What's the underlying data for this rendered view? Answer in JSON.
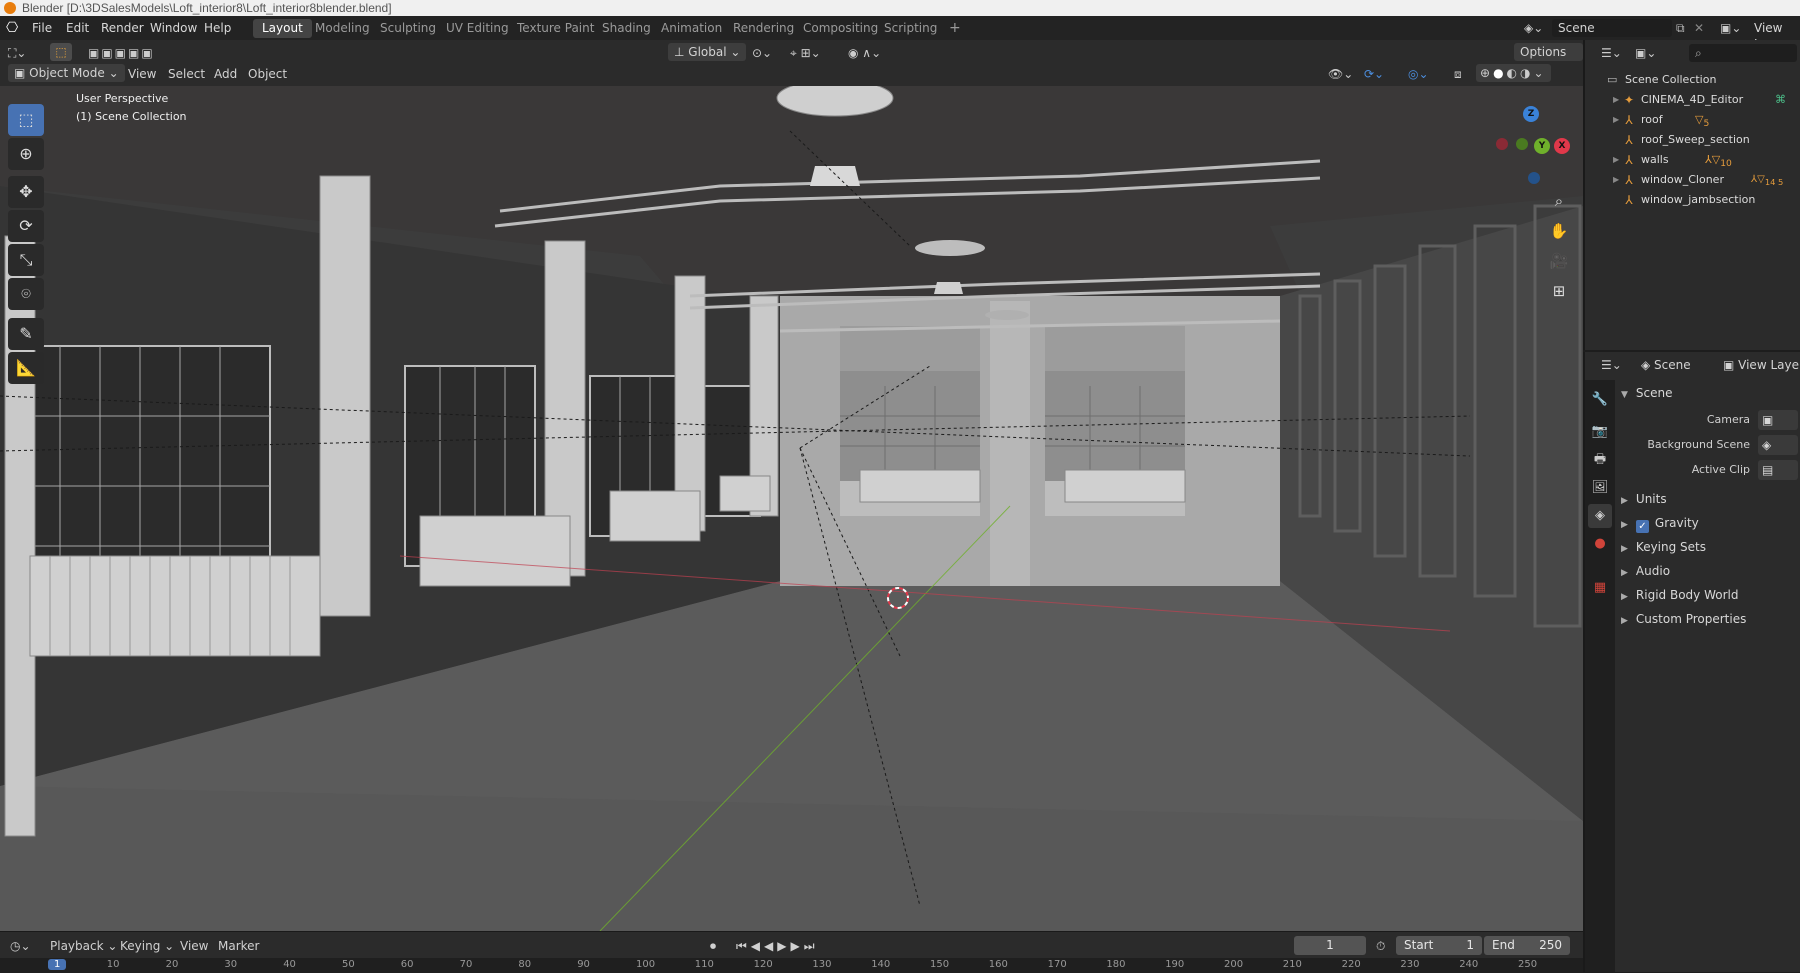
{
  "window": {
    "title": "Blender [D:\\3DSalesModels\\Loft_interior8\\Loft_interior8blender.blend]"
  },
  "menu": [
    "File",
    "Edit",
    "Render",
    "Window",
    "Help"
  ],
  "workspaces": [
    "Layout",
    "Modeling",
    "Sculpting",
    "UV Editing",
    "Texture Paint",
    "Shading",
    "Animation",
    "Rendering",
    "Compositing",
    "Scripting"
  ],
  "active_workspace": "Layout",
  "add_workspace": "+",
  "scene_selector": {
    "label": "Scene",
    "view_layer": "View Lay"
  },
  "viewport_header": {
    "mode": "Object Mode",
    "menus": [
      "View",
      "Select",
      "Add",
      "Object"
    ],
    "orientation": "Global",
    "options": "Options"
  },
  "viewport_overlay": {
    "perspective": "User Perspective",
    "collection": "(1) Scene Collection"
  },
  "gizmo": {
    "x": "X",
    "y": "Y",
    "z": "Z"
  },
  "outliner": {
    "root": "Scene Collection",
    "items": [
      {
        "name": "CINEMA_4D_Editor",
        "badge": ""
      },
      {
        "name": "roof",
        "badge": "5"
      },
      {
        "name": "roof_Sweep_section",
        "badge": ""
      },
      {
        "name": "walls",
        "badge": "10"
      },
      {
        "name": "window_Cloner",
        "badge": "14 5"
      },
      {
        "name": "window_jambsection",
        "badge": ""
      }
    ]
  },
  "properties": {
    "header_scene": "Scene",
    "header_view_layer": "View Laye",
    "panel_title": "Scene",
    "fields": [
      {
        "label": "Camera"
      },
      {
        "label": "Background Scene"
      },
      {
        "label": "Active Clip"
      }
    ],
    "sections": [
      "Units",
      "Gravity",
      "Keying Sets",
      "Audio",
      "Rigid Body World",
      "Custom Properties"
    ],
    "gravity_checked": true
  },
  "timeline": {
    "menus": [
      "Playback",
      "Keying",
      "View",
      "Marker"
    ],
    "current_frame": "1",
    "start_label": "Start",
    "start": "1",
    "end_label": "End",
    "end": "250",
    "ruler": [
      "1",
      "10",
      "20",
      "30",
      "40",
      "50",
      "60",
      "70",
      "80",
      "90",
      "100",
      "110",
      "120",
      "130",
      "140",
      "150",
      "160",
      "170",
      "180",
      "190",
      "200",
      "210",
      "220",
      "230",
      "240",
      "250"
    ]
  },
  "colors": {
    "accent": "#4772b3",
    "brand": "#e87d0d",
    "axis_x": "#e0384a",
    "axis_y": "#6fb02b",
    "axis_z": "#3a82d8"
  }
}
